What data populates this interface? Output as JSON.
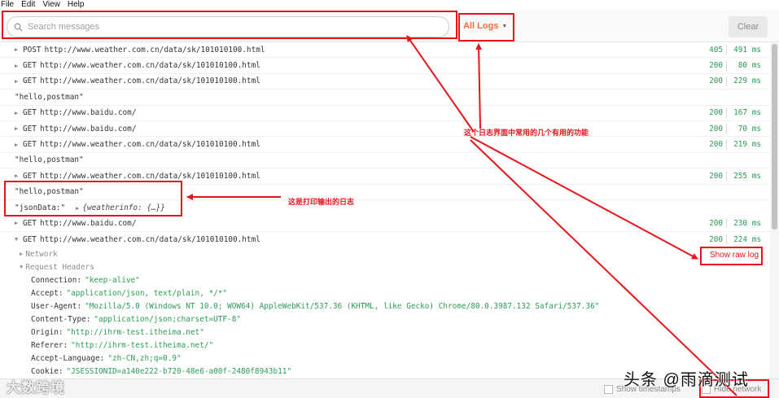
{
  "menu": [
    "File",
    "Edit",
    "View",
    "Help"
  ],
  "toolbar": {
    "search_placeholder": "Search messages",
    "filter_label": "All Logs",
    "clear_label": "Clear"
  },
  "logs": [
    {
      "kind": "request",
      "method": "POST",
      "url": "http://www.weather.com.cn/data/sk/101010100.html",
      "status": "405",
      "time": "491 ms"
    },
    {
      "kind": "request",
      "method": "GET",
      "url": "http://www.weather.com.cn/data/sk/101010100.html",
      "status": "200",
      "time": "80 ms"
    },
    {
      "kind": "request",
      "method": "GET",
      "url": "http://www.weather.com.cn/data/sk/101010100.html",
      "status": "200",
      "time": "229 ms"
    },
    {
      "kind": "string",
      "text": "\"hello,postman\""
    },
    {
      "kind": "request",
      "method": "GET",
      "url": "http://www.baidu.com/",
      "status": "200",
      "time": "167 ms"
    },
    {
      "kind": "request",
      "method": "GET",
      "url": "http://www.baidu.com/",
      "status": "200",
      "time": "70 ms"
    },
    {
      "kind": "request",
      "method": "GET",
      "url": "http://www.weather.com.cn/data/sk/101010100.html",
      "status": "200",
      "time": "219 ms"
    },
    {
      "kind": "string",
      "text": "\"hello,postman\""
    },
    {
      "kind": "request",
      "method": "GET",
      "url": "http://www.weather.com.cn/data/sk/101010100.html",
      "status": "200",
      "time": "255 ms"
    },
    {
      "kind": "string",
      "text": "\"hello,postman\""
    },
    {
      "kind": "json",
      "key": "\"jsonData:\"",
      "value": "{weatherinfo: {…}}"
    },
    {
      "kind": "request",
      "method": "GET",
      "url": "http://www.baidu.com/",
      "status": "200",
      "time": "230 ms"
    },
    {
      "kind": "request-open",
      "method": "GET",
      "url": "http://www.weather.com.cn/data/sk/101010100.html",
      "status": "200",
      "time": "224 ms"
    }
  ],
  "detail": {
    "network_label": "Network",
    "request_headers_label": "Request Headers",
    "headers": [
      {
        "name": "Connection:",
        "value": "\"keep-alive\""
      },
      {
        "name": "Accept:",
        "value": "\"application/json, text/plain, */*\""
      },
      {
        "name": "User-Agent:",
        "value": "\"Mozilla/5.0 (Windows NT 10.0; WOW64) AppleWebKit/537.36 (KHTML, like Gecko) Chrome/80.0.3987.132 Safari/537.36\""
      },
      {
        "name": "Content-Type:",
        "value": "\"application/json;charset=UTF-8\""
      },
      {
        "name": "Origin:",
        "value": "\"http://ihrm-test.itheima.net\""
      },
      {
        "name": "Referer:",
        "value": "\"http://ihrm-test.itheima.net/\""
      },
      {
        "name": "Accept-Language:",
        "value": "\"zh-CN,zh;q=0.9\""
      },
      {
        "name": "Cookie:",
        "value": "\"JSESSIONID=a140e222-b720-48e6-a00f-2480f8943b11\""
      }
    ]
  },
  "statusbar": {
    "show_timestamps": "Show timestamps",
    "hide_network": "Hide network"
  },
  "annotations": {
    "features_note": "这个日志界面中常用的几个有用的功能",
    "log_output_note": "这是打印输出的日志",
    "show_raw_log": "Show raw log"
  },
  "watermarks": {
    "left": "大数跨境",
    "right": "头条 @雨滴测试"
  },
  "colors": {
    "accent": "#f26b3a",
    "status_ok": "#2a9d57",
    "annotation": "#e8141b"
  }
}
